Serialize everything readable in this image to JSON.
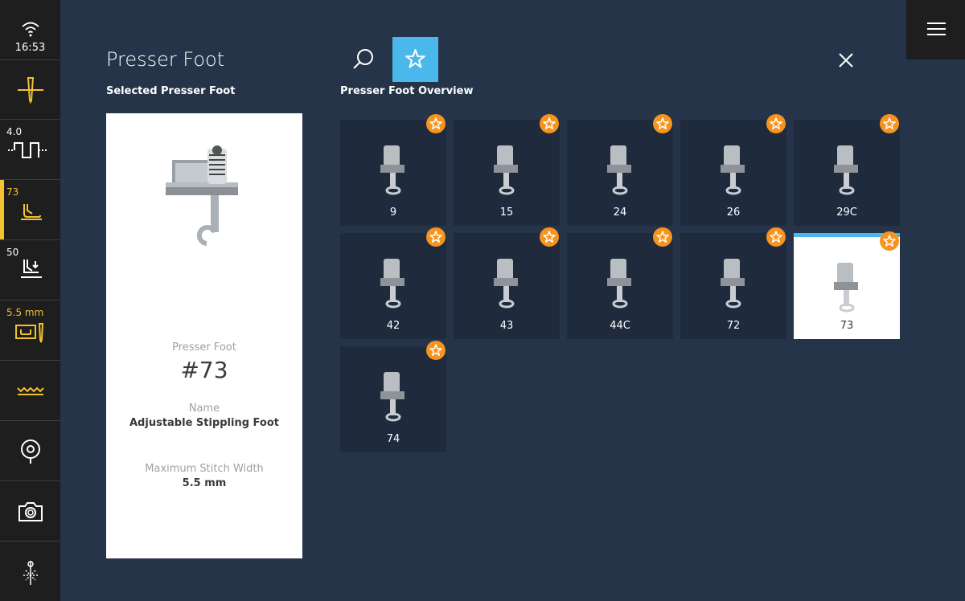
{
  "status": {
    "time": "16:53",
    "stitch_length": "4.0",
    "presser_foot": "73",
    "presser_pressure": "50",
    "stitch_width": "5.5 mm",
    "colors": {
      "accent": "#f2c230",
      "highlight": "#4ab8ea",
      "star": "#f7941d"
    }
  },
  "header": {
    "title": "Presser Foot",
    "selected_heading": "Selected Presser Foot",
    "overview_heading": "Presser Foot Overview"
  },
  "selected": {
    "foot_label": "Presser Foot",
    "foot_number": "#73",
    "name_label": "Name",
    "name": "Adjustable Stippling Foot",
    "width_label": "Maximum Stitch Width",
    "width": "5.5 mm"
  },
  "feet": [
    {
      "label": "9"
    },
    {
      "label": "15"
    },
    {
      "label": "24"
    },
    {
      "label": "26"
    },
    {
      "label": "29C"
    },
    {
      "label": "42"
    },
    {
      "label": "43"
    },
    {
      "label": "44C"
    },
    {
      "label": "72"
    },
    {
      "label": "73",
      "selected": true
    },
    {
      "label": "74"
    }
  ]
}
